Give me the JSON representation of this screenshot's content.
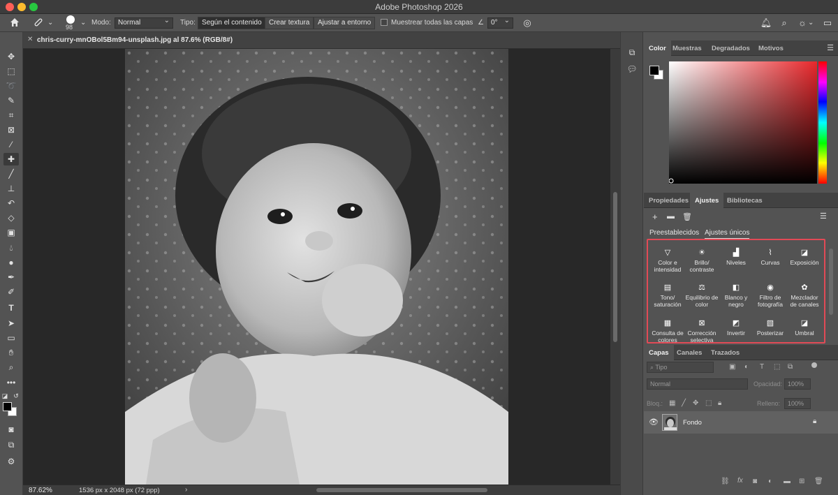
{
  "app": {
    "title": "Adobe Photoshop 2026"
  },
  "options_bar": {
    "brush_size": "98",
    "mode_label": "Modo:",
    "mode_value": "Normal",
    "type_label": "Tipo:",
    "type_buttons": [
      "Según el contenido",
      "Crear textura",
      "Ajustar a entorno"
    ],
    "sample_all_label": "Muestrear todas las capas",
    "angle_value": "0°"
  },
  "document": {
    "tab_title": "chris-curry-mnOBol5Bm94-unsplash.jpg al 87.6% (RGB/8#)",
    "zoom": "87.62%",
    "info": "1536 px x 2048 px (72 ppp)",
    "status_arrow": "›"
  },
  "color_panel": {
    "tabs": [
      "Color",
      "Muestras",
      "Degradados",
      "Motivos"
    ],
    "active_tab": "Color",
    "hue_color": "#e8272b"
  },
  "adjustments_panel": {
    "tabs": [
      "Propiedades",
      "Ajustes",
      "Bibliotecas"
    ],
    "active_tab": "Ajustes",
    "subtabs": [
      "Preestablecidos",
      "Ajustes únicos"
    ],
    "items": [
      {
        "label": "Color e intensidad",
        "icon": "▽"
      },
      {
        "label": "Brillo/ contraste",
        "icon": "☀"
      },
      {
        "label": "Niveles",
        "icon": "▟"
      },
      {
        "label": "Curvas",
        "icon": "⌇"
      },
      {
        "label": "Exposición",
        "icon": "◪"
      },
      {
        "label": "Tono/ saturación",
        "icon": "▤"
      },
      {
        "label": "Equilibrio de color",
        "icon": "⚖"
      },
      {
        "label": "Blanco y negro",
        "icon": "◧"
      },
      {
        "label": "Filtro de fotografía",
        "icon": "◉"
      },
      {
        "label": "Mezclador de canales",
        "icon": "✿"
      },
      {
        "label": "Consulta de colores",
        "icon": "▦"
      },
      {
        "label": "Corrección selectiva",
        "icon": "⊠"
      },
      {
        "label": "Invertir",
        "icon": "◩"
      },
      {
        "label": "Posterizar",
        "icon": "▧"
      },
      {
        "label": "Umbral",
        "icon": "◪"
      }
    ]
  },
  "layers_panel": {
    "tabs": [
      "Capas",
      "Canales",
      "Trazados"
    ],
    "active_tab": "Capas",
    "filter_placeholder": "Tipo",
    "blend_mode": "Normal",
    "opacity_label": "Opacidad:",
    "opacity_value": "100%",
    "lock_label": "Bloq.:",
    "fill_label": "Relleno:",
    "fill_value": "100%",
    "layer_name": "Fondo"
  }
}
